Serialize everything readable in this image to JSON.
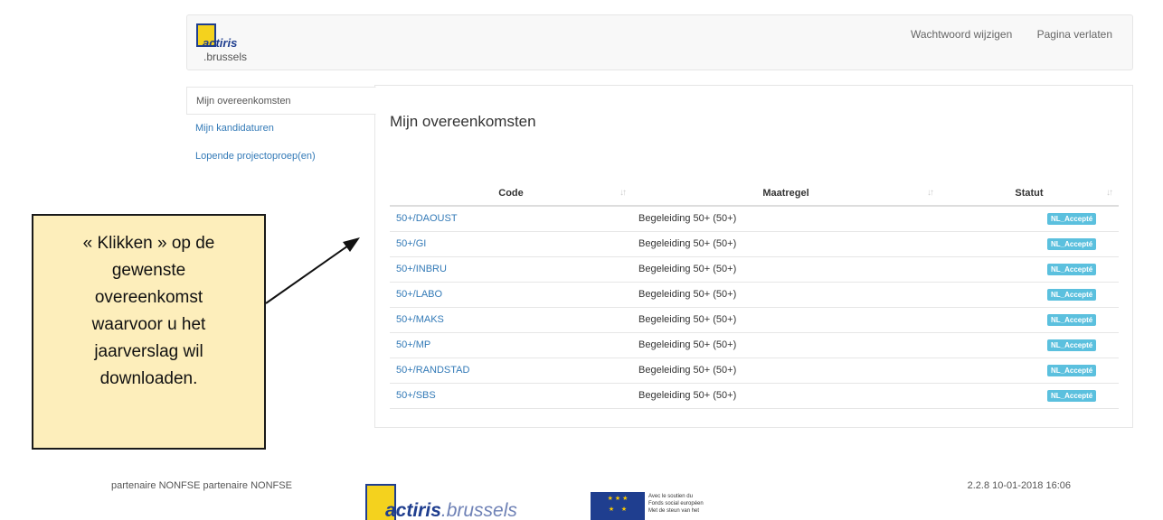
{
  "header": {
    "logo_line1": "actiris",
    "logo_line2": ".brussels",
    "links": [
      "Wachtwoord wijzigen",
      "Pagina verlaten"
    ]
  },
  "sidebar": {
    "items": [
      {
        "label": "Mijn overeenkomsten",
        "active": true
      },
      {
        "label": "Mijn kandidaturen",
        "active": false
      },
      {
        "label": "Lopende projectoproep(en)",
        "active": false
      }
    ]
  },
  "main": {
    "title": "Mijn overeenkomsten",
    "columns": [
      "Code",
      "Maatregel",
      "Statut"
    ],
    "sort_icon": "sort-icon",
    "rows": [
      {
        "code": "50+/DAOUST",
        "maatregel": "Begeleiding 50+ (50+)",
        "statut": "NL_Accepté"
      },
      {
        "code": "50+/GI",
        "maatregel": "Begeleiding 50+ (50+)",
        "statut": "NL_Accepté"
      },
      {
        "code": "50+/INBRU",
        "maatregel": "Begeleiding 50+ (50+)",
        "statut": "NL_Accepté"
      },
      {
        "code": "50+/LABO",
        "maatregel": "Begeleiding 50+ (50+)",
        "statut": "NL_Accepté"
      },
      {
        "code": "50+/MAKS",
        "maatregel": "Begeleiding 50+ (50+)",
        "statut": "NL_Accepté"
      },
      {
        "code": "50+/MP",
        "maatregel": "Begeleiding 50+ (50+)",
        "statut": "NL_Accepté"
      },
      {
        "code": "50+/RANDSTAD",
        "maatregel": "Begeleiding 50+ (50+)",
        "statut": "NL_Accepté"
      },
      {
        "code": "50+/SBS",
        "maatregel": "Begeleiding 50+ (50+)",
        "statut": "NL_Accepté"
      }
    ]
  },
  "callout": {
    "lines": [
      "« Klikken » op de",
      "gewenste",
      "overeenkomst",
      "waarvoor u het",
      "jaarverslag wil",
      "downloaden."
    ]
  },
  "footer": {
    "left_text": "partenaire NONFSE partenaire NONFSE",
    "version": "2.2.8 10-01-2018 16:06",
    "logo_text_a": "actiris",
    "logo_text_b": ".brussels",
    "eu_text": [
      "Avec le soutien du",
      "Fonds social européen",
      "Met de steun van het"
    ]
  },
  "colors": {
    "link": "#337ab7",
    "badge": "#5bc0de",
    "callout_bg": "#fdeebb",
    "brand_blue": "#1f3e8f",
    "brand_yellow": "#f4d21e"
  }
}
